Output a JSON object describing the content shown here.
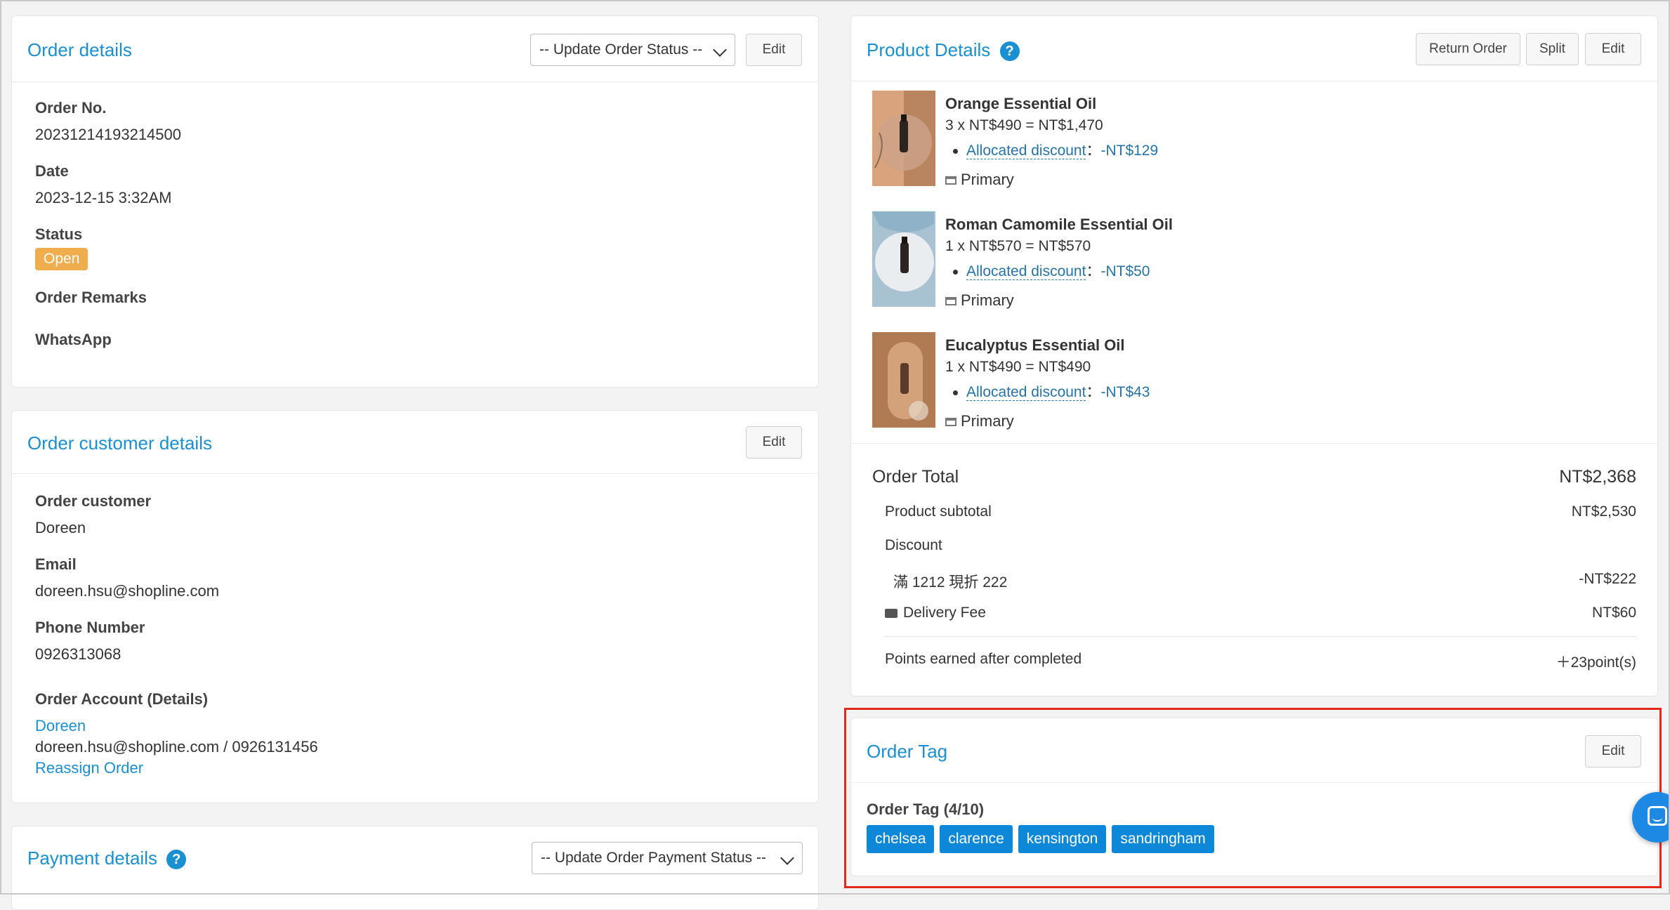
{
  "order_details": {
    "title": "Order details",
    "status_select": "-- Update Order Status --",
    "edit_label": "Edit",
    "order_no_label": "Order No.",
    "order_no": "20231214193214500",
    "date_label": "Date",
    "date": "2023-12-15 3:32AM",
    "status_label": "Status",
    "status": "Open",
    "remarks_label": "Order Remarks",
    "whatsapp_label": "WhatsApp"
  },
  "customer": {
    "title": "Order customer details",
    "edit_label": "Edit",
    "customer_label": "Order customer",
    "customer": "Doreen",
    "email_label": "Email",
    "email": "doreen.hsu@shopline.com",
    "phone_label": "Phone Number",
    "phone": "0926313068",
    "account_label": "Order Account (Details)",
    "account_name": "Doreen",
    "account_info": "doreen.hsu@shopline.com / 0926131456",
    "reassign_label": "Reassign Order"
  },
  "payment": {
    "title": "Payment details",
    "status_select": "-- Update Order Payment Status --"
  },
  "products": {
    "title": "Product Details",
    "help_icon": "?",
    "return_label": "Return Order",
    "split_label": "Split",
    "edit_label": "Edit",
    "items": [
      {
        "name": "Orange Essential Oil",
        "line": "3 x NT$490 = NT$1,470",
        "discount_label": "Allocated discount",
        "discount_sep": "：",
        "discount": "-NT$129",
        "warehouse": "Primary"
      },
      {
        "name": "Roman Camomile Essential Oil",
        "line": "1 x NT$570 = NT$570",
        "discount_label": "Allocated discount",
        "discount_sep": "：",
        "discount": "-NT$50",
        "warehouse": "Primary"
      },
      {
        "name": "Eucalyptus Essential Oil",
        "line": "1 x NT$490 = NT$490",
        "discount_label": "Allocated discount",
        "discount_sep": "：",
        "discount": "-NT$43",
        "warehouse": "Primary"
      }
    ],
    "summary": {
      "total_label": "Order Total",
      "total": "NT$2,368",
      "subtotal_label": "Product subtotal",
      "subtotal": "NT$2,530",
      "discount_label": "Discount",
      "promo_label": "滿 1212 現折 222",
      "promo": "-NT$222",
      "delivery_label": "Delivery Fee",
      "delivery": "NT$60",
      "points_label": "Points earned after completed",
      "points": "＋23point(s)"
    }
  },
  "order_tag": {
    "title": "Order Tag",
    "edit_label": "Edit",
    "count_label": "Order Tag (4/10)",
    "tags": [
      "chelsea",
      "clarence",
      "kensington",
      "sandringham"
    ]
  },
  "colors": {
    "accent": "#1a8fd1",
    "status_open": "#f0ad4e",
    "tag": "#0d87d8",
    "highlight": "#e3291c"
  }
}
